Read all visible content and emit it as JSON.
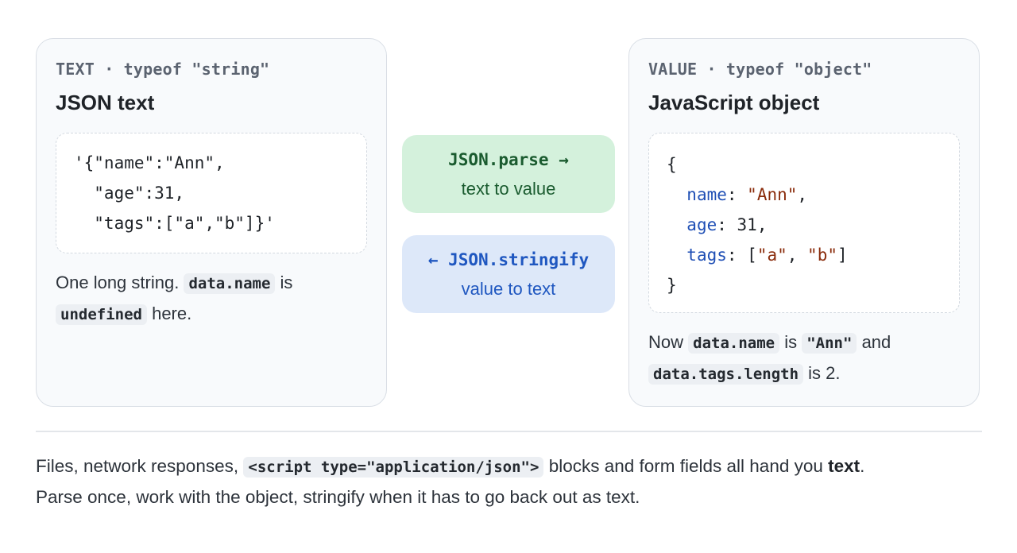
{
  "left_card": {
    "eyebrow": "TEXT · typeof \"string\"",
    "title": "JSON text",
    "code_lines": [
      "'{\"name\":\"Ann\",",
      "  \"age\":31,",
      "  \"tags\":[\"a\",\"b\"]}'"
    ],
    "note": {
      "part1": "One long string.",
      "code1": "data.name",
      "part2": "is",
      "code2": "undefined",
      "part3": "here."
    }
  },
  "parse_pill": {
    "code": "JSON.parse →",
    "label": "text to value"
  },
  "stringify_pill": {
    "code": "← JSON.stringify",
    "label": "value to text"
  },
  "right_card": {
    "eyebrow": "VALUE · typeof \"object\"",
    "title": "JavaScript object",
    "code": {
      "open": "{",
      "close": "}",
      "name_key": "name",
      "name_val": "\"Ann\"",
      "age_key": "age",
      "age_val": "31",
      "tags_key": "tags",
      "tag_a": "\"a\"",
      "tag_b": "\"b\""
    },
    "note": {
      "part1": "Now",
      "code1": "data.name",
      "part2": "is",
      "code2": "\"Ann\"",
      "part3": "and",
      "code3": "data.tags.length",
      "part4": "is 2."
    }
  },
  "footer": {
    "part1": "Files, network responses,",
    "code": "<script type=\"application/json\">",
    "part2": "blocks and form fields all hand you",
    "bold": "text",
    "part3": ".",
    "line2": "Parse once, work with the object, stringify when it has to go back out as text."
  },
  "colors": {
    "parse_bg": "#d4f1dc",
    "parse_fg": "#1a5b2f",
    "stringify_bg": "#dde8f9",
    "stringify_fg": "#1f57c0",
    "key": "#1f4fb5",
    "string": "#8a2c0c"
  }
}
